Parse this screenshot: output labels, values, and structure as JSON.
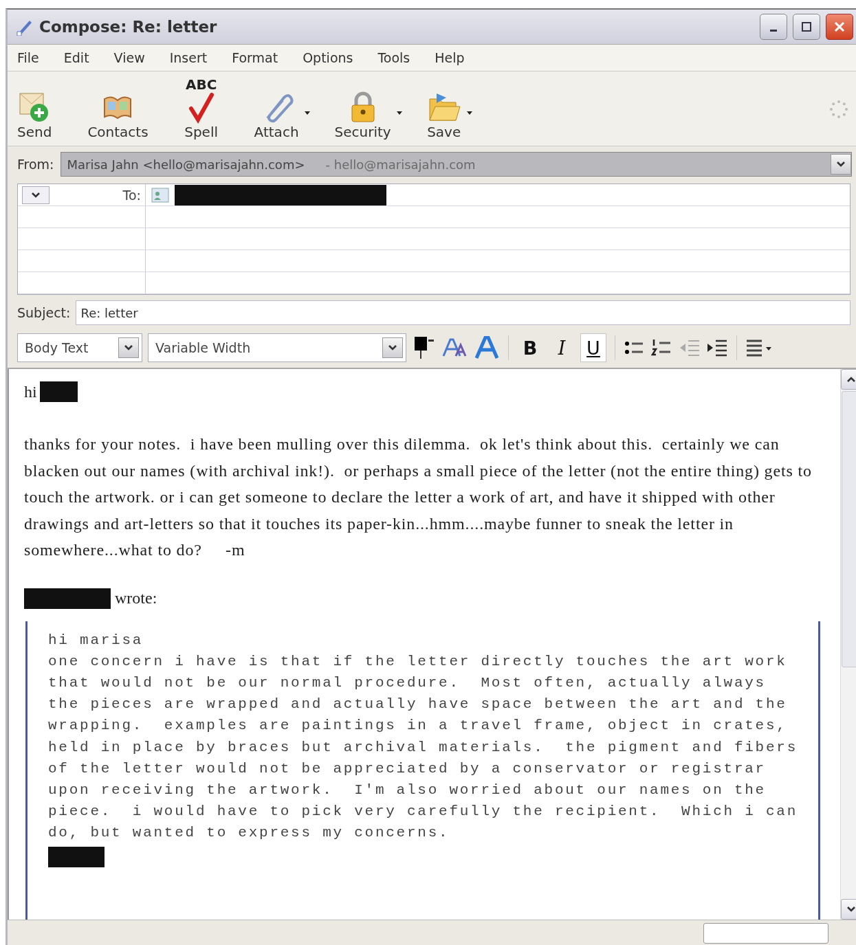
{
  "window": {
    "title": "Compose: Re: letter"
  },
  "menu": [
    "File",
    "Edit",
    "View",
    "Insert",
    "Format",
    "Options",
    "Tools",
    "Help"
  ],
  "toolbar": [
    {
      "kind": "send",
      "label": "Send",
      "has_menu": false
    },
    {
      "kind": "contacts",
      "label": "Contacts",
      "has_menu": false
    },
    {
      "kind": "spell",
      "label": "Spell",
      "icon_text": "ABC",
      "has_menu": false
    },
    {
      "kind": "attach",
      "label": "Attach",
      "has_menu": true
    },
    {
      "kind": "security",
      "label": "Security",
      "has_menu": true
    },
    {
      "kind": "save",
      "label": "Save",
      "has_menu": true
    }
  ],
  "from": {
    "label": "From:",
    "identity": "Marisa Jahn <hello@marisajahn.com>",
    "account": "- hello@marisajahn.com"
  },
  "to": {
    "label": "To:"
  },
  "subject": {
    "label": "Subject:",
    "value": "Re: letter"
  },
  "format_bar": {
    "paragraph_style": "Body Text",
    "font": "Variable Width",
    "buttons": [
      {
        "label": "B",
        "kind": "bold",
        "pressed": false
      },
      {
        "label": "I",
        "kind": "italic",
        "pressed": false
      },
      {
        "label": "U",
        "kind": "underline",
        "pressed": true
      }
    ]
  },
  "body": {
    "greeting": "hi",
    "reply": "thanks for your notes.  i have been mulling over this dilemma.  ok let's think about this.  certainly we can blacken out our names (with archival ink!).  or perhaps a small piece of the letter (not the entire thing) gets to touch the artwork. or i can get someone to declare the letter a work of art, and have it shipped with other drawings and art-letters so that it touches its paper-kin...hmm....maybe funner to sneak the letter in somewhere...what to do?     -m",
    "attribution": "wrote:",
    "quote": [
      "hi marisa",
      "one concern i have is that if the letter directly touches the art work",
      "that would not be our normal procedure.  Most often, actually always",
      "the pieces are wrapped and actually have space between the art and the",
      "wrapping.  examples are paintings in a travel frame, object in crates,",
      "held in place by braces but archival materials.  the pigment and fibers",
      "of the letter would not be appreciated by a conservator or registrar",
      "upon receiving the artwork.  I'm also worried about our names on the",
      "piece.  i would have to pick very carefully the recipient.  Which i can",
      "do, but wanted to express my concerns."
    ]
  }
}
